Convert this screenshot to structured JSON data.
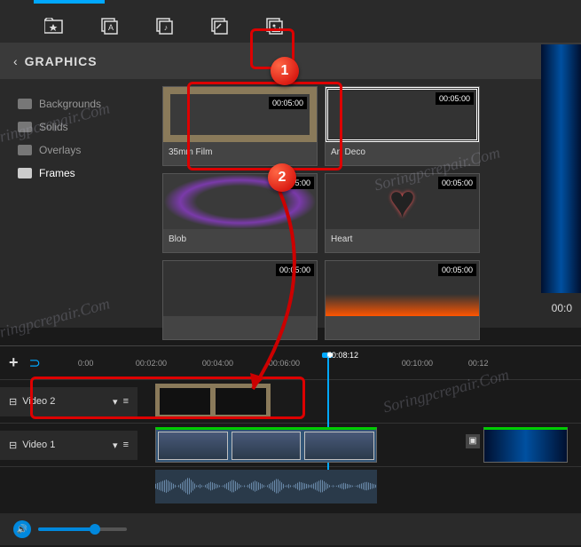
{
  "panel": {
    "title": "GRAPHICS",
    "categories": [
      {
        "label": "Backgrounds",
        "selected": false
      },
      {
        "label": "Solids",
        "selected": false
      },
      {
        "label": "Overlays",
        "selected": false
      },
      {
        "label": "Frames",
        "selected": true
      }
    ]
  },
  "graphics": {
    "items": [
      {
        "name": "35mm Film",
        "duration": "00:05:00",
        "style": "film"
      },
      {
        "name": "Art Deco",
        "duration": "00:05:00",
        "style": "artdeco"
      },
      {
        "name": "Blob",
        "duration": "00:05:00",
        "style": "blob"
      },
      {
        "name": "Heart",
        "duration": "00:05:00",
        "style": "heart"
      },
      {
        "name": "",
        "duration": "00:05:00",
        "style": "dark"
      },
      {
        "name": "",
        "duration": "00:05:00",
        "style": "fire"
      }
    ]
  },
  "preview": {
    "time": "00:0"
  },
  "timeline": {
    "ticks": [
      "0:00",
      "00:02:00",
      "00:04:00",
      "00:06:00",
      "",
      "00:10:00",
      "00:12"
    ],
    "playhead": "00:08:12",
    "tracks": [
      {
        "name": "Video 2"
      },
      {
        "name": "Video 1"
      }
    ]
  },
  "callouts": {
    "one": "1",
    "two": "2"
  },
  "watermark": "Soringpcrepair.Com"
}
